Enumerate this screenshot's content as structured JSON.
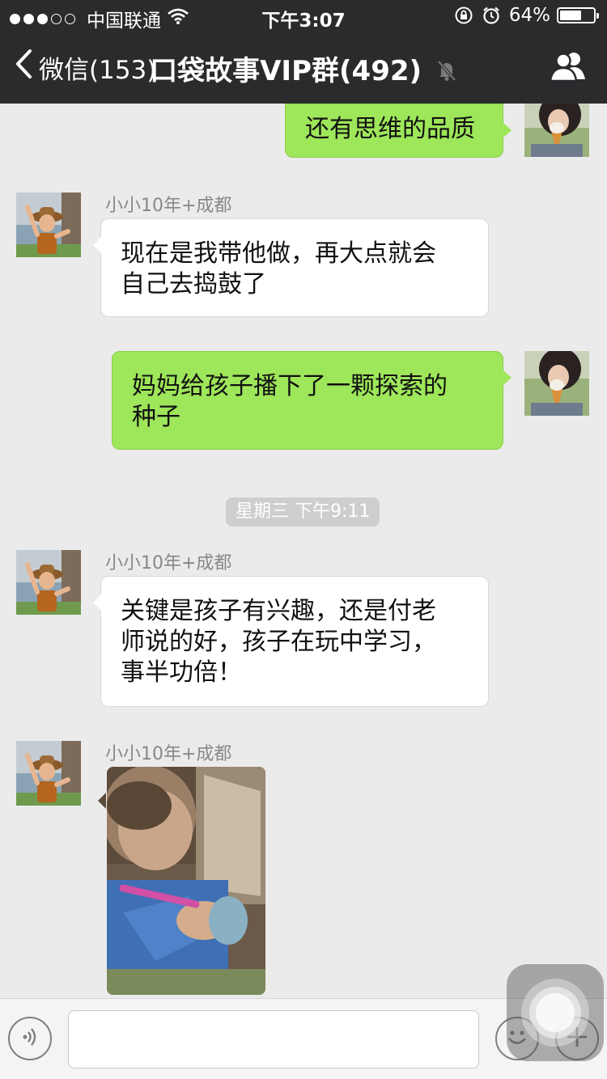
{
  "status_bar": {
    "carrier": "中国联通",
    "time": "下午3:07",
    "battery_percent": "64%",
    "battery_level": 0.64,
    "signal_bars_filled": 3,
    "signal_bars_total": 5
  },
  "nav": {
    "back_label": "微信(153)",
    "title": "口袋故事VIP群(492)"
  },
  "messages": [
    {
      "direction": "outgoing",
      "text": "还有思维的品质"
    },
    {
      "direction": "incoming",
      "sender": "小小10年+成都",
      "text": "现在是我带他做，再大点就会自己去捣鼓了"
    },
    {
      "direction": "outgoing",
      "text": "妈妈给孩子播下了一颗探索的种子"
    },
    {
      "timestamp": "星期三 下午9:11"
    },
    {
      "direction": "incoming",
      "sender": "小小10年+成都",
      "text": "关键是孩子有兴趣，还是付老师说的好，孩子在玩中学习，事半功倍！"
    },
    {
      "direction": "incoming",
      "sender": "小小10年+成都",
      "type": "image"
    }
  ],
  "msg": {
    "m1_text": "还有思维的品质",
    "m2_sender": "小小10年+成都",
    "m2_line1": "现在是我带他做，再大点就会",
    "m2_line2": "自己去捣鼓了",
    "m3_line1": "妈妈给孩子播下了一颗探索的",
    "m3_line2": "种子",
    "timestamp": "星期三 下午9:11",
    "m4_sender": "小小10年+成都",
    "m4_line1": "关键是孩子有兴趣，还是付老",
    "m4_line2": "师说的好，孩子在玩中学习，",
    "m4_line3": "事半功倍！",
    "m5_sender": "小小10年+成都"
  },
  "input_bar": {
    "voice_icon": "voice-icon",
    "emoji_icon": "emoji-icon",
    "more_icon": "plus-icon"
  },
  "colors": {
    "nav_bg": "#2b2b2e",
    "chat_bg": "#ebebeb",
    "outgoing_bubble": "#9ee65a",
    "incoming_bubble": "#ffffff",
    "sender_text": "#888888"
  }
}
